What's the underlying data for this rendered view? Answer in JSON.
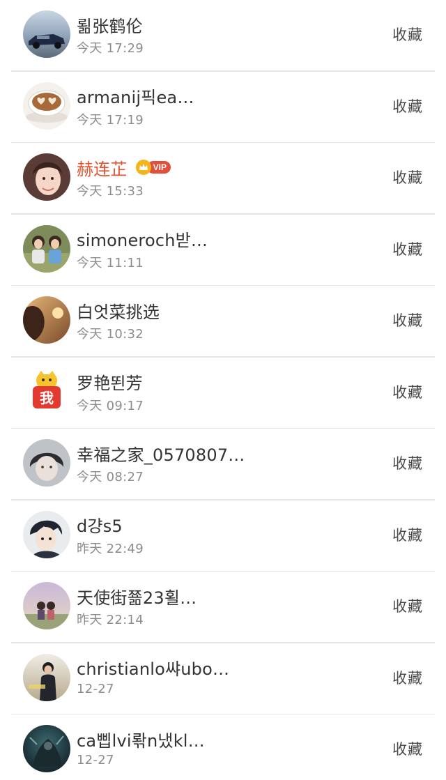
{
  "collect_label": "收藏",
  "rows": [
    {
      "name": "뢺张鹤伦",
      "time": "今天 17:29",
      "avatar_icon": "car-avatar-icon"
    },
    {
      "name": "armanij픽ea…",
      "time": "今天 17:19",
      "avatar_icon": "coffee-heart-avatar-icon"
    },
    {
      "name": "赫连芷",
      "time": "今天 15:33",
      "avatar_icon": "girl-portrait-avatar-icon",
      "vip": true,
      "vip_label": "VIP"
    },
    {
      "name": "simoneroch받…",
      "time": "今天 11:11",
      "avatar_icon": "two-children-avatar-icon"
    },
    {
      "name": "白엇菜挑选",
      "time": "今天 10:32",
      "avatar_icon": "sunset-silhouette-avatar-icon"
    },
    {
      "name": "罗艳뙨芳",
      "time": "今天 09:17",
      "avatar_icon": "cartoon-cat-avatar-icon",
      "avatar_text": "我"
    },
    {
      "name": "幸福之家_0570807…",
      "time": "今天 08:27",
      "avatar_icon": "grey-portrait-avatar-icon"
    },
    {
      "name": "d걍s5",
      "time": "昨天 22:49",
      "avatar_icon": "anime-boy-avatar-icon"
    },
    {
      "name": "天使街쬶23횔…",
      "time": "昨天 22:14",
      "avatar_icon": "couple-sky-avatar-icon"
    },
    {
      "name": "christianlo쌰ubo…",
      "time": "12-27",
      "avatar_icon": "man-standing-avatar-icon"
    },
    {
      "name": "ca삡lvi롺n냈kl…",
      "time": "12-27",
      "avatar_icon": "dark-fantasy-avatar-icon"
    }
  ],
  "colors": {
    "name": "#333333",
    "vip_name": "#e4532f",
    "time": "#8c8c8c",
    "divider": "#e6e6e6",
    "vip_badge": "#e0503a",
    "vip_crown": "#f3b51d"
  }
}
